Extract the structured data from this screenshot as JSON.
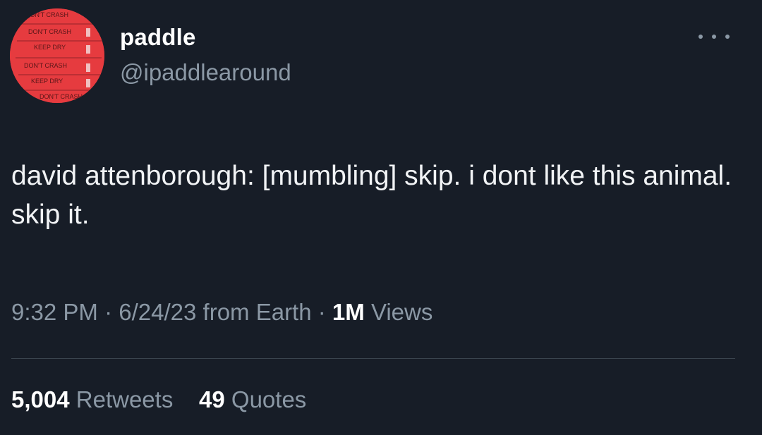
{
  "author": {
    "display_name": "paddle",
    "handle": "@ipaddlearound",
    "avatar": {
      "background": "#e63b3f",
      "stamp_text": [
        "DON'T CRASH",
        "KEEP DRY",
        "DON'T CRASH",
        "KEEP DRY",
        "DON'T CRASH"
      ]
    }
  },
  "menu": {
    "icon": "more-horizontal-icon"
  },
  "tweet": {
    "text": "david attenborough: [mumbling] skip. i dont like this animal. skip it."
  },
  "meta": {
    "time": "9:32 PM",
    "separator": "·",
    "date": "6/24/23",
    "source": "from Earth",
    "views_count": "1M",
    "views_label": "Views"
  },
  "stats": {
    "retweets_count": "5,004",
    "retweets_label": "Retweets",
    "quotes_count": "49",
    "quotes_label": "Quotes"
  },
  "colors": {
    "background": "#171d27",
    "primary_text": "#ffffff",
    "secondary_text": "#8b98a5",
    "divider": "#3a444e"
  }
}
